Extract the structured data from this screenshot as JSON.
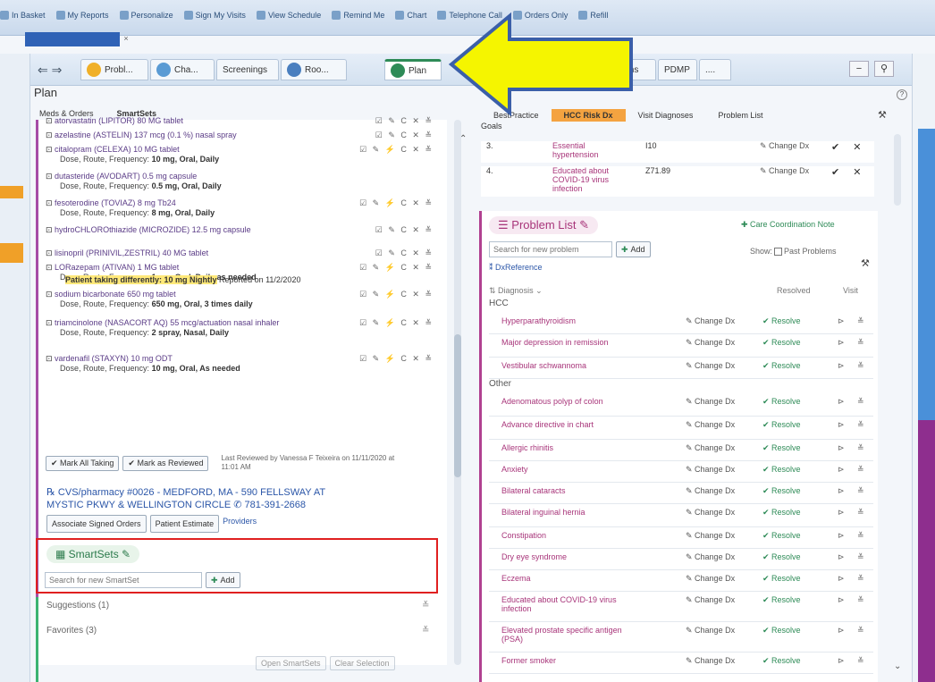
{
  "toolbar": {
    "items": [
      "In Basket",
      "My Reports",
      "Personalize",
      "Sign My Visits",
      "View Schedule",
      "Remind Me",
      "Chart",
      "Telephone Call",
      "Orders Only",
      "Refill"
    ]
  },
  "patient_tab": {
    "close": "×"
  },
  "activity_tabs": {
    "nav": "⇐ ⇒",
    "tabs": [
      "Probl...",
      "Cha...",
      "Screenings",
      "Roo...",
      "Plan",
      "ms",
      "PDMP",
      "...."
    ]
  },
  "plan": {
    "title": "Plan",
    "help": "?",
    "subtabs": [
      "Meds & Orders",
      "SmartSets"
    ]
  },
  "meds": [
    {
      "name": "atorvastatin (LIPITOR) 80 MG tablet",
      "dose": "",
      "actions": "☑ ✎ C ✕ ≚"
    },
    {
      "name": "azelastine (ASTELIN) 137 mcg (0.1 %) nasal spray",
      "dose": "",
      "actions": "☑ ✎ C ✕ ≚"
    },
    {
      "name": "citalopram (CELEXA) 10 MG tablet",
      "dose_label": "Dose, Route, Frequency:",
      "dose": "10 mg, Oral, Daily",
      "actions": "☑ ✎ ⚡ C ✕ ≚"
    },
    {
      "name": "dutasteride (AVODART) 0.5 mg capsule",
      "dose_label": "Dose, Route, Frequency:",
      "dose": "0.5 mg, Oral, Daily",
      "actions": ""
    },
    {
      "name": "fesoterodine (TOVIAZ) 8 mg Tb24",
      "dose_label": "Dose, Route, Frequency:",
      "dose": "8 mg, Oral, Daily",
      "actions": "☑ ✎ ⚡ C ✕ ≚"
    },
    {
      "name": "hydroCHLOROthiazide (MICROZIDE) 12.5 mg capsule",
      "dose": "",
      "actions": "☑ ✎ C ✕ ≚"
    },
    {
      "name": "lisinopril (PRINIVIL,ZESTRIL) 40 MG tablet",
      "dose": "",
      "actions": "☑ ✎ C ✕ ≚"
    },
    {
      "name": "LORazepam (ATIVAN) 1 MG tablet",
      "dose_label": "Dose, Route, Frequency:",
      "dose": "1 mg, Oral, Daily as needed",
      "actions": "☑ ✎ ⚡ C ✕ ≚"
    },
    {
      "name": "sodium bicarbonate 650 mg tablet",
      "dose_label": "Dose, Route, Frequency:",
      "dose": "650 mg, Oral, 3 times daily",
      "actions": "☑ ✎ ⚡ C ✕ ≚"
    },
    {
      "name": "triamcinolone (NASACORT AQ) 55 mcg/actuation nasal inhaler",
      "dose_label": "Dose, Route, Frequency:",
      "dose": "2 spray, Nasal, Daily",
      "actions": "☑ ✎ ⚡ C ✕ ≚"
    },
    {
      "name": "vardenafil (STAXYN) 10 mg ODT",
      "dose_label": "Dose, Route, Frequency:",
      "dose": "10 mg, Oral, As needed",
      "actions": "☑ ✎ ⚡ C ✕ ≚"
    }
  ],
  "lisinopril_note": {
    "highlight": "Patient taking differently: 10 mg Nightly",
    "reported": "Reported on 11/2/2020"
  },
  "review": {
    "mark_all": "✔ Mark All Taking",
    "mark_reviewed": "✔ Mark as Reviewed",
    "last_reviewed": "Last Reviewed by Vanessa F Teixeira on 11/11/2020 at 11:01 AM"
  },
  "pharmacy": {
    "line1": "CVS/pharmacy #0026 - MEDFORD, MA - 590 FELLSWAY AT",
    "line2": "MYSTIC PKWY & WELLINGTON CIRCLE",
    "phone": "781-391-2668",
    "associate": "Associate Signed Orders",
    "estimate": "Patient Estimate",
    "providers": "Providers"
  },
  "smartsets": {
    "title": "SmartSets",
    "placeholder": "Search for new SmartSet",
    "add": "Add",
    "suggestions": "Suggestions (1)",
    "favorites": "Favorites (3)",
    "open": "Open SmartSets",
    "clear": "Clear Selection"
  },
  "right_tabs": [
    "BestPractice",
    "HCC Risk Dx",
    "Visit Diagnoses",
    "Problem List"
  ],
  "goals": {
    "label": "Goals",
    "rows": [
      {
        "num": "3.",
        "dx": "Essential hypertension",
        "code": "I10",
        "change": "✎ Change Dx",
        "marks": "✔ ✕"
      },
      {
        "num": "4.",
        "dx": "Educated about COVID-19 virus infection",
        "code": "Z71.89",
        "change": "✎ Change Dx",
        "marks": "✔ ✕"
      }
    ]
  },
  "problem_list": {
    "title": "Problem List",
    "care_note": "Care Coordination Note",
    "placeholder": "Search for new problem",
    "add": "Add",
    "show": "Show:",
    "past": "Past Problems",
    "dxref": "DxReference",
    "col_dx": "Diagnosis",
    "col_resolved": "Resolved",
    "col_visit": "Visit",
    "groups": [
      {
        "name": "HCC",
        "items": [
          "Hyperparathyroidism",
          "Major depression in remission",
          "Vestibular schwannoma"
        ]
      },
      {
        "name": "Other",
        "items": [
          "Adenomatous polyp of colon",
          "Advance directive in chart",
          "Allergic rhinitis",
          "Anxiety",
          "Bilateral cataracts",
          "Bilateral inguinal hernia",
          "Constipation",
          "Dry eye syndrome",
          "Eczema",
          "Educated about COVID-19 virus infection",
          "Elevated prostate specific antigen (PSA)",
          "Former smoker"
        ]
      }
    ],
    "change": "✎ Change Dx",
    "resolve": "✔ Resolve"
  },
  "colors": {
    "arrow": "#f5f500",
    "arrow_outline": "#3b5fa8",
    "red_box": "#e02020",
    "hcc_tab": "#f4a340"
  }
}
